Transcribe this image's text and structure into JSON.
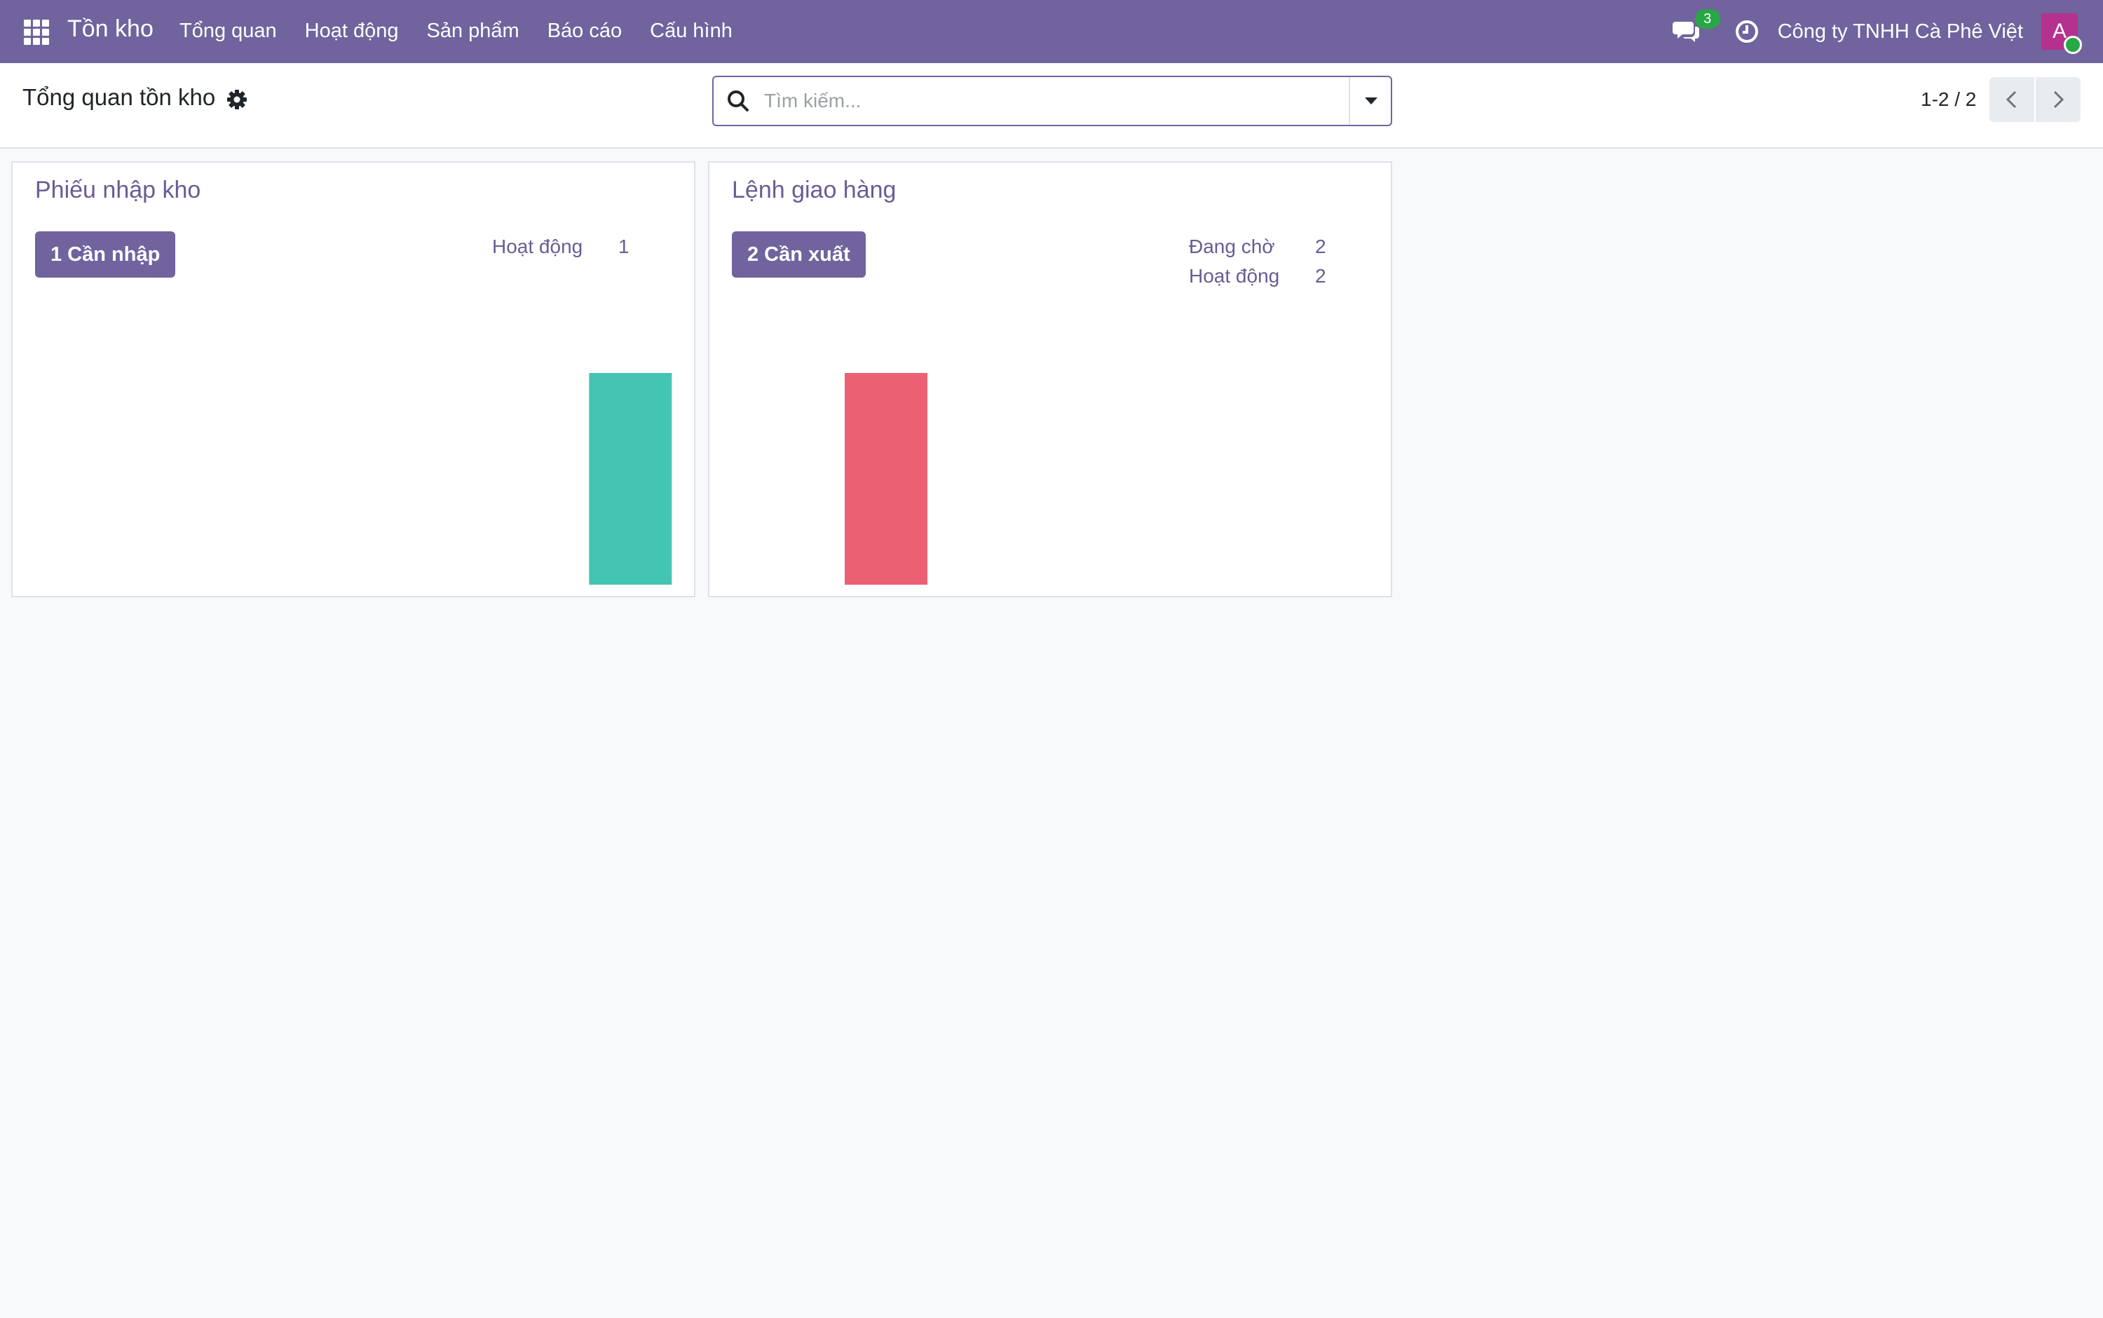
{
  "navbar": {
    "app_name": "Tồn kho",
    "menu": [
      "Tổng quan",
      "Hoạt động",
      "Sản phẩm",
      "Báo cáo",
      "Cấu hình"
    ],
    "chat_badge": "3",
    "company": "Công ty TNHH Cà Phê Việt",
    "avatar_letter": "A",
    "icons": [
      "apps-grid-icon",
      "chat-icon",
      "clock-icon"
    ],
    "color": "#71639e"
  },
  "control_panel": {
    "title": "Tổng quan tồn kho",
    "title_icon": "gear-icon",
    "search_placeholder": "Tìm kiếm...",
    "pager": "1-2 / 2"
  },
  "cards": [
    {
      "title": "Phiếu nhập kho",
      "button": "1 Cần nhập",
      "stats": [
        {
          "label": "Hoạt động",
          "value": "1"
        }
      ],
      "chart_color": "#43c5b2"
    },
    {
      "title": "Lệnh giao hàng",
      "button": "2 Cần xuất",
      "stats": [
        {
          "label": "Đang chờ",
          "value": "2"
        },
        {
          "label": "Hoạt động",
          "value": "2"
        }
      ],
      "chart_color": "#eb6173"
    }
  ],
  "chart_data": [
    {
      "type": "bar",
      "categories": [
        "",
        "",
        "",
        "",
        "",
        ""
      ],
      "values": [
        0,
        0,
        0,
        0,
        0,
        1
      ],
      "color": "#43c5b2",
      "title": "",
      "xlabel": "",
      "ylabel": "",
      "grid": false
    },
    {
      "type": "bar",
      "categories": [
        "",
        "",
        "",
        "",
        "",
        ""
      ],
      "values": [
        0,
        1,
        0,
        0,
        0,
        0
      ],
      "color": "#eb6173",
      "title": "",
      "xlabel": "",
      "ylabel": "",
      "grid": false
    }
  ]
}
